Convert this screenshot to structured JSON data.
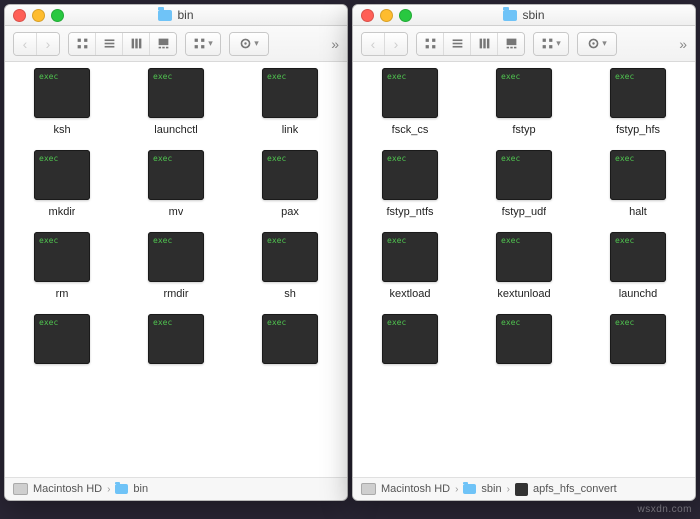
{
  "exec_badge": "exec",
  "windows": [
    {
      "id": "left",
      "title": "bin",
      "items": [
        "ksh",
        "launchctl",
        "link",
        "mkdir",
        "mv",
        "pax",
        "rm",
        "rmdir",
        "sh",
        "",
        "",
        ""
      ],
      "path": [
        {
          "kind": "disk",
          "label": "Macintosh HD"
        },
        {
          "kind": "folder",
          "label": "bin"
        }
      ]
    },
    {
      "id": "right",
      "title": "sbin",
      "items": [
        "fsck_cs",
        "fstyp",
        "fstyp_hfs",
        "fstyp_ntfs",
        "fstyp_udf",
        "halt",
        "kextload",
        "kextunload",
        "launchd",
        "",
        "",
        ""
      ],
      "path": [
        {
          "kind": "disk",
          "label": "Macintosh HD"
        },
        {
          "kind": "folder",
          "label": "sbin"
        },
        {
          "kind": "file",
          "label": "apfs_hfs_convert"
        }
      ]
    }
  ],
  "watermark": "wsxdn.com"
}
